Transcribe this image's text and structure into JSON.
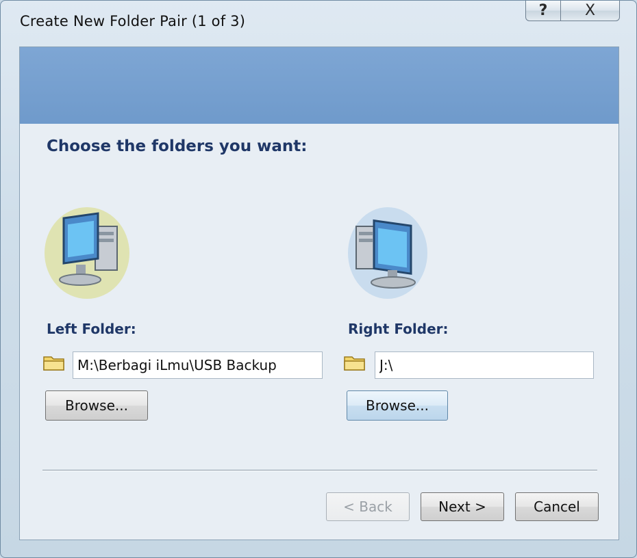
{
  "window": {
    "title": "Create New Folder Pair (1 of 3)",
    "help_glyph": "?",
    "close_glyph": "X"
  },
  "main": {
    "heading": "Choose the folders you want:",
    "left": {
      "label": "Left Folder:",
      "path": "M:\\Berbagi iLmu\\USB Backup",
      "browse_label": "Browse...",
      "icon": "computer-icon",
      "halo_color": "#dfe3b2"
    },
    "right": {
      "label": "Right Folder:",
      "path": "J:\\",
      "browse_label": "Browse...",
      "icon": "computer-icon",
      "halo_color": "#c9dcee"
    }
  },
  "footer": {
    "back_label": "< Back",
    "next_label": "Next >",
    "cancel_label": "Cancel"
  },
  "colors": {
    "banner": "#7ea6d4",
    "heading_text": "#1f3767",
    "folder_icon": "#f2d56a"
  }
}
